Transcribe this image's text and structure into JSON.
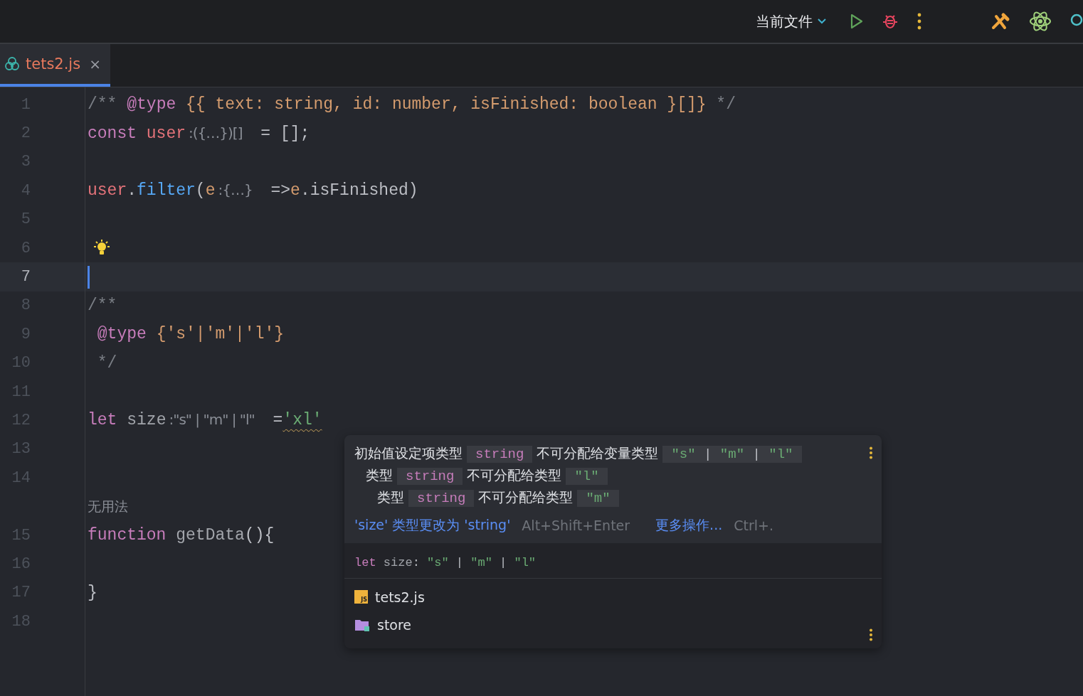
{
  "toolbar": {
    "run_config": "当前文件"
  },
  "tabs": [
    {
      "label": "tets2.js",
      "close": "×",
      "selected": true
    }
  ],
  "editor": {
    "rows": [
      {
        "kind": "code",
        "number": "1",
        "current": false,
        "tokens": [
          {
            "text": "/** ",
            "kind": "comment"
          },
          {
            "text": "@type",
            "kind": "doctag"
          },
          {
            "text": " {{ text: string, id: number, isFinished: boolean }[]}",
            "kind": "doctype"
          },
          {
            "text": " */",
            "kind": "comment"
          }
        ]
      },
      {
        "kind": "code",
        "number": "2",
        "current": false,
        "tokens": [
          {
            "text": "const",
            "kind": "keyword"
          },
          {
            "text": " user",
            "kind": "var"
          },
          {
            "text": ":({…})[]",
            "kind": "hint"
          },
          {
            "text": " = [];",
            "kind": "plain"
          }
        ]
      },
      {
        "kind": "code",
        "number": "3",
        "current": false
      },
      {
        "kind": "code",
        "number": "4",
        "current": false,
        "tokens": [
          {
            "text": "user",
            "kind": "var"
          },
          {
            "text": ".",
            "kind": "plain"
          },
          {
            "text": "filter",
            "kind": "func"
          },
          {
            "text": "(",
            "kind": "plain"
          },
          {
            "text": "e",
            "kind": "param"
          },
          {
            "text": ":{…}",
            "kind": "hint"
          },
          {
            "text": " =>",
            "kind": "plain"
          },
          {
            "text": "e",
            "kind": "param"
          },
          {
            "text": ".isFinished)",
            "kind": "plain"
          }
        ]
      },
      {
        "kind": "code",
        "number": "5",
        "current": false
      },
      {
        "kind": "code",
        "number": "6",
        "current": false,
        "lightbulb": true
      },
      {
        "kind": "code",
        "number": "7",
        "current": true
      },
      {
        "kind": "code",
        "number": "8",
        "current": false,
        "tokens": [
          {
            "text": "/**",
            "kind": "comment"
          }
        ]
      },
      {
        "kind": "code",
        "number": "9",
        "current": false,
        "tokens": [
          {
            "text": " @type",
            "kind": "doctag"
          },
          {
            "text": " {'s'|'m'|'l'}",
            "kind": "doctype"
          }
        ]
      },
      {
        "kind": "code",
        "number": "10",
        "current": false,
        "tokens": [
          {
            "text": " */",
            "kind": "comment"
          }
        ]
      },
      {
        "kind": "code",
        "number": "11",
        "current": false
      },
      {
        "kind": "code",
        "number": "12",
        "current": false,
        "tokens": [
          {
            "text": "let",
            "kind": "keyword"
          },
          {
            "text": " size",
            "kind": "unused"
          },
          {
            "text": ":\"s\" | \"m\" | \"l\"",
            "kind": "hint"
          },
          {
            "text": " =",
            "kind": "plain"
          },
          {
            "text": "'xl'",
            "kind": "string",
            "warn": true
          }
        ]
      },
      {
        "kind": "code",
        "number": "13",
        "current": false
      },
      {
        "kind": "code",
        "number": "14",
        "current": false
      },
      {
        "kind": "usage",
        "text": "无用法"
      },
      {
        "kind": "code",
        "number": "15",
        "current": false,
        "tokens": [
          {
            "text": "function",
            "kind": "keyword"
          },
          {
            "text": " getData",
            "kind": "unused"
          },
          {
            "text": "(){",
            "kind": "plain"
          }
        ]
      },
      {
        "kind": "code",
        "number": "16",
        "current": false
      },
      {
        "kind": "code",
        "number": "17",
        "current": false,
        "tokens": [
          {
            "text": "}",
            "kind": "plain"
          }
        ]
      },
      {
        "kind": "code",
        "number": "18",
        "current": false
      }
    ]
  },
  "popup": {
    "message": {
      "parts": [
        {
          "kind": "text",
          "text": "初始值设定项类型"
        },
        {
          "kind": "code",
          "tokens": [
            {
              "text": "string",
              "kind": "type"
            }
          ]
        },
        {
          "kind": "text",
          "text": "不可分配给变量类型"
        },
        {
          "kind": "code",
          "tokens": [
            {
              "text": "\"s\"",
              "kind": "string"
            },
            {
              "text": " | ",
              "kind": "plain"
            },
            {
              "text": "\"m\"",
              "kind": "string"
            },
            {
              "text": " | ",
              "kind": "plain"
            },
            {
              "text": "\"l\"",
              "kind": "string"
            }
          ]
        }
      ],
      "children": [
        {
          "parts": [
            {
              "kind": "text",
              "text": "类型"
            },
            {
              "kind": "code",
              "tokens": [
                {
                  "text": "string",
                  "kind": "type"
                }
              ]
            },
            {
              "kind": "text",
              "text": "不可分配给类型"
            },
            {
              "kind": "code",
              "tokens": [
                {
                  "text": "\"l\"",
                  "kind": "string"
                }
              ]
            }
          ],
          "children": [
            {
              "parts": [
                {
                  "kind": "text",
                  "text": "类型"
                },
                {
                  "kind": "code",
                  "tokens": [
                    {
                      "text": "string",
                      "kind": "type"
                    }
                  ]
                },
                {
                  "kind": "text",
                  "text": "不可分配给类型"
                },
                {
                  "kind": "code",
                  "tokens": [
                    {
                      "text": "\"m\"",
                      "kind": "string"
                    }
                  ]
                }
              ]
            }
          ]
        }
      ]
    },
    "actions": [
      {
        "label": "'size' 类型更改为 'string'",
        "shortcut": "Alt+Shift+Enter"
      },
      {
        "label": "更多操作...",
        "shortcut": "Ctrl+."
      }
    ],
    "declaration": [
      {
        "text": "let",
        "kind": "keyword"
      },
      {
        "text": " size",
        "kind": "unused"
      },
      {
        "text": ": ",
        "kind": "plain"
      },
      {
        "text": "\"s\"",
        "kind": "string"
      },
      {
        "text": " | ",
        "kind": "plain"
      },
      {
        "text": "\"m\"",
        "kind": "string"
      },
      {
        "text": " | ",
        "kind": "plain"
      },
      {
        "text": "\"l\"",
        "kind": "string"
      }
    ],
    "locations": [
      {
        "label": "tets2.js",
        "kind": "js-file",
        "icon_text": "JS"
      },
      {
        "label": "store",
        "kind": "folder"
      }
    ]
  }
}
